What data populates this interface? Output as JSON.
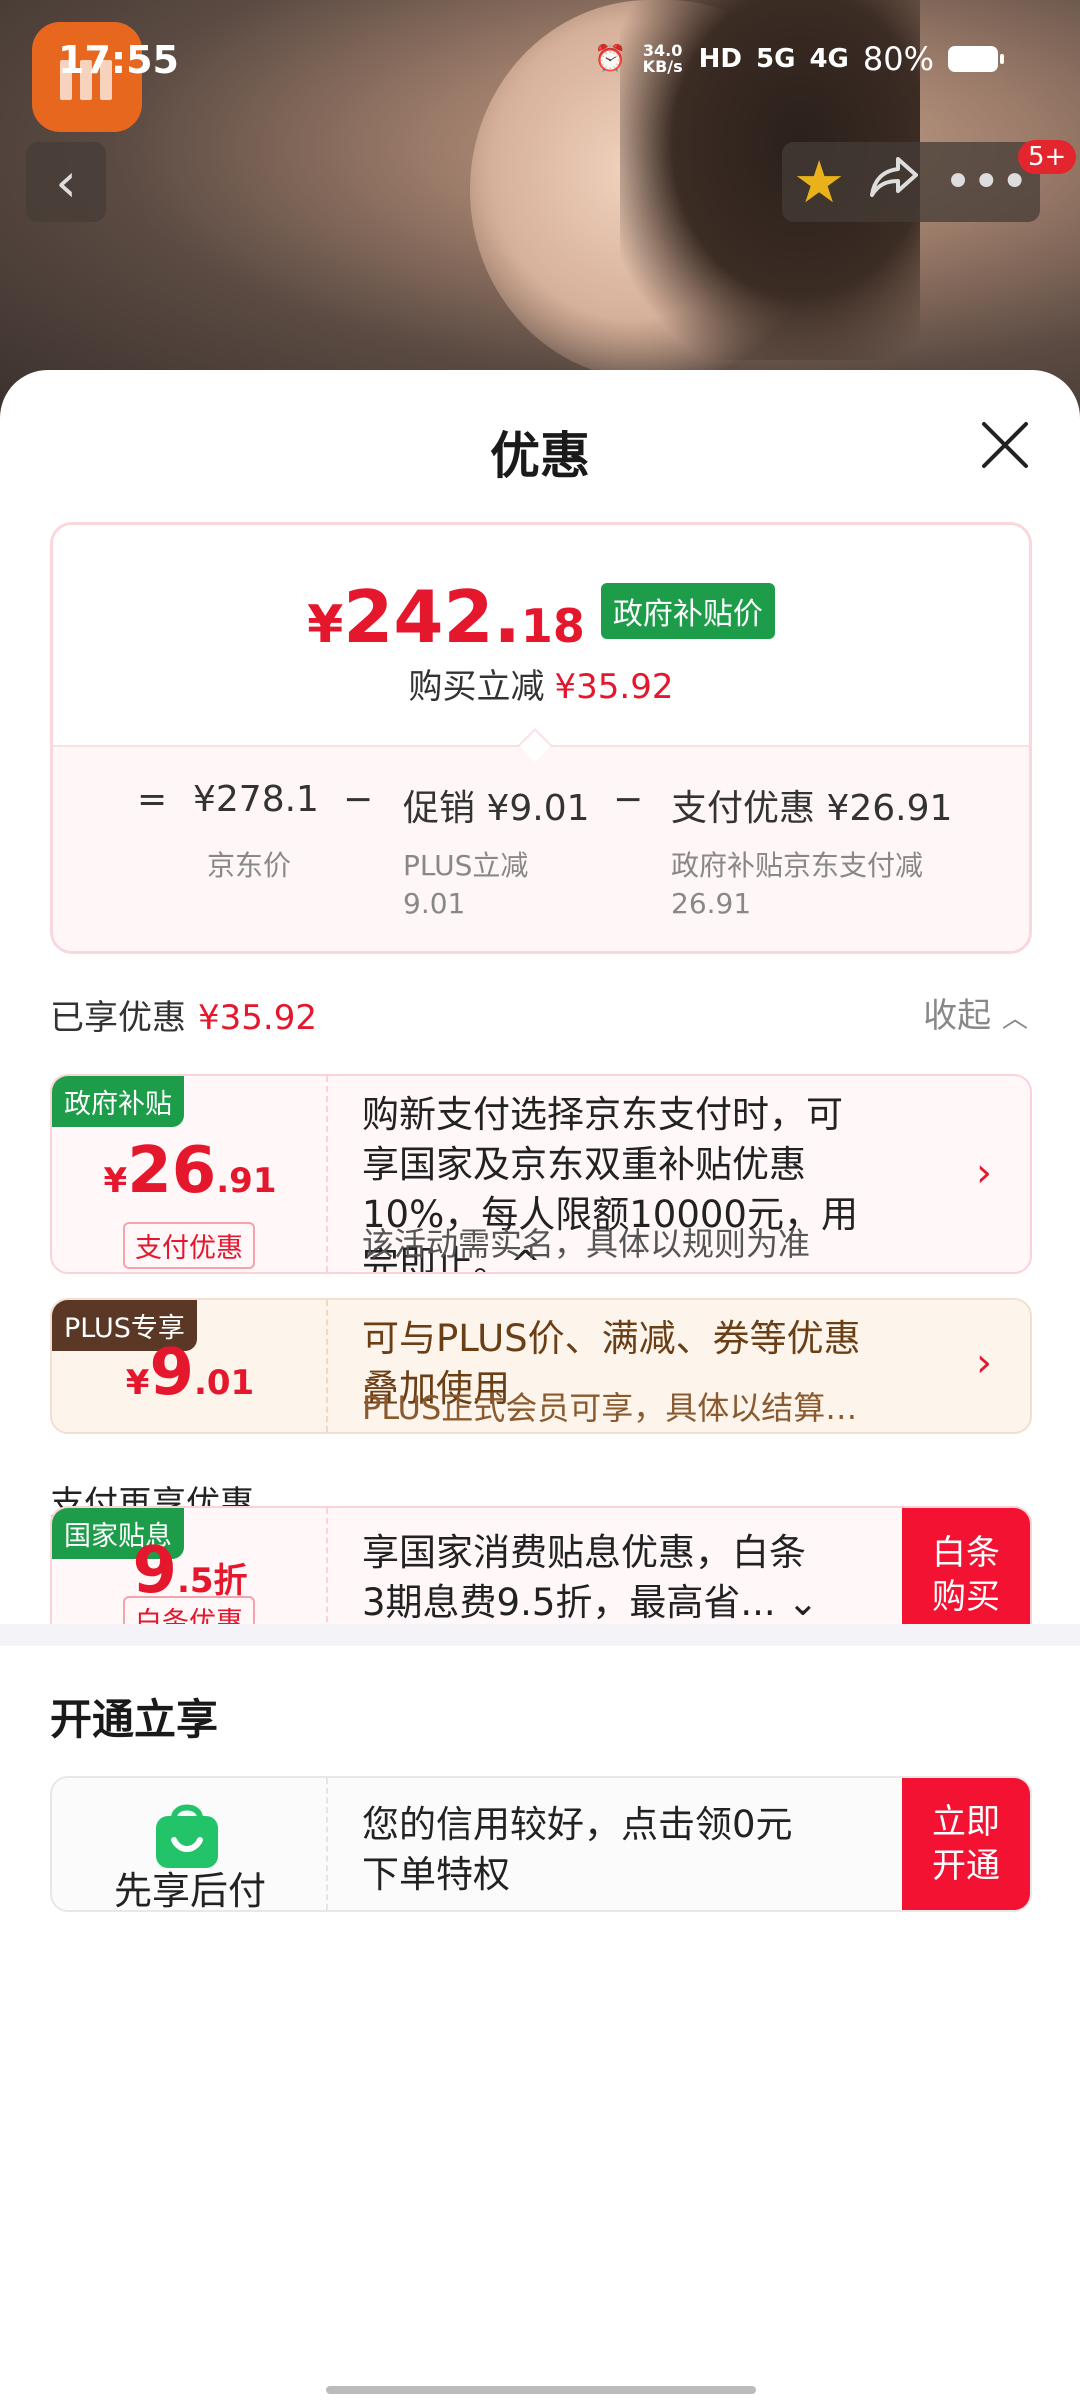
{
  "status_bar": {
    "time": "17:55",
    "net_speed": "34.0 KB/s",
    "hd": "HD",
    "sig_5g": "5G",
    "sig_4g": "4G",
    "battery": "80%"
  },
  "top_bar": {
    "more_badge": "5+"
  },
  "sheet": {
    "title": "优惠"
  },
  "summary": {
    "price_yen": "¥",
    "price_int": "242.",
    "price_dec": "18",
    "price_tag": "政府补贴价",
    "reduce_label": "购买立减",
    "reduce_value": "¥35.92",
    "eq": "=",
    "jd_price": "¥278.1",
    "minus1": "−",
    "promo": "促销 ¥9.01",
    "minus2": "−",
    "pay_discount": "支付优惠 ¥26.91",
    "jd_price_label": "京东价",
    "promo_sub1": "PLUS立减",
    "promo_sub2": "9.01",
    "pay_sub1": "政府补贴京东支付减",
    "pay_sub2": "26.91"
  },
  "enjoyed": {
    "label": "已享优惠",
    "value": "¥35.92",
    "collapse": "收起"
  },
  "deals": {
    "gov": {
      "tag": "政府补贴",
      "yen": "¥",
      "int": "26",
      "dec": ".91",
      "chip": "支付优惠",
      "line1": "购新支付选择京东支付时，可",
      "line2": "享国家及京东双重补贴优惠",
      "line3": "10%，每人限额10000元，用",
      "line4": "完即止。^",
      "sub": "该活动需实名，具体以规则为准"
    },
    "plus": {
      "tag": "PLUS专享",
      "yen": "¥",
      "int": "9",
      "dec": ".01",
      "line1": "可与PLUS价、满减、券等优惠",
      "line2": "叠加使用",
      "sub": "PLUS正式会员可享，具体以结算…"
    }
  },
  "pay_section": {
    "label": "支付再享优惠",
    "tag": "国家贴息",
    "int": "9",
    "dec": ".5折",
    "chip": "白条优惠",
    "line1": "享国家消费贴息优惠，白条",
    "line2": "3期息费9.5折，最高省... ⌄",
    "btn_line1": "白条",
    "btn_line2": "购买"
  },
  "open_section": {
    "title": "开通立享",
    "name": "先享后付",
    "line1": "您的信用较好，点击领0元",
    "line2": "下单特权",
    "btn_line1": "立即",
    "btn_line2": "开通"
  },
  "colors": {
    "accent_red": "#e5172d",
    "gov_green": "#1d9d4a",
    "plus_brown": "#6b3f16",
    "button_red": "#f31232"
  }
}
